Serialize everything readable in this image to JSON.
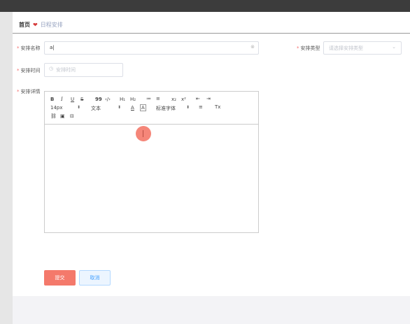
{
  "breadcrumb": {
    "home": "首页",
    "separator_icon": "heart-icon",
    "current": "日程安排"
  },
  "form": {
    "name": {
      "label": "安排名称",
      "value": "a|",
      "clear_icon": "circle-close-icon"
    },
    "type": {
      "label": "安排类型",
      "placeholder": "请选择安排类型",
      "arrow_icon": "chevron-down-icon"
    },
    "time": {
      "label": "安排时间",
      "placeholder": "安排时间",
      "clock_icon": "clock-icon"
    },
    "detail": {
      "label": "安排详情"
    }
  },
  "toolbar": {
    "bold": "B",
    "italic": "I",
    "underline": "U",
    "strike": "S",
    "quote": "99",
    "code": "‹/›",
    "h1": "H₁",
    "h2": "H₂",
    "ordered_list": "≔",
    "bullet_list": "≡",
    "subscript": "x₂",
    "superscript": "x²",
    "indent_out": "⇤",
    "indent_in": "⇥",
    "font_size": "14px",
    "text_style": "文本",
    "font_color": "A",
    "bg_color": "A",
    "font_family": "标准字体",
    "align": "≡",
    "clear_format": "Tx",
    "link": "🔗",
    "image": "▣",
    "video": "⊟"
  },
  "buttons": {
    "submit": "提交",
    "cancel": "取消"
  },
  "colors": {
    "accent": "#f4796b",
    "cancel_bg": "#ecf5ff",
    "cancel_text": "#409eff",
    "required": "#f56c6c"
  }
}
